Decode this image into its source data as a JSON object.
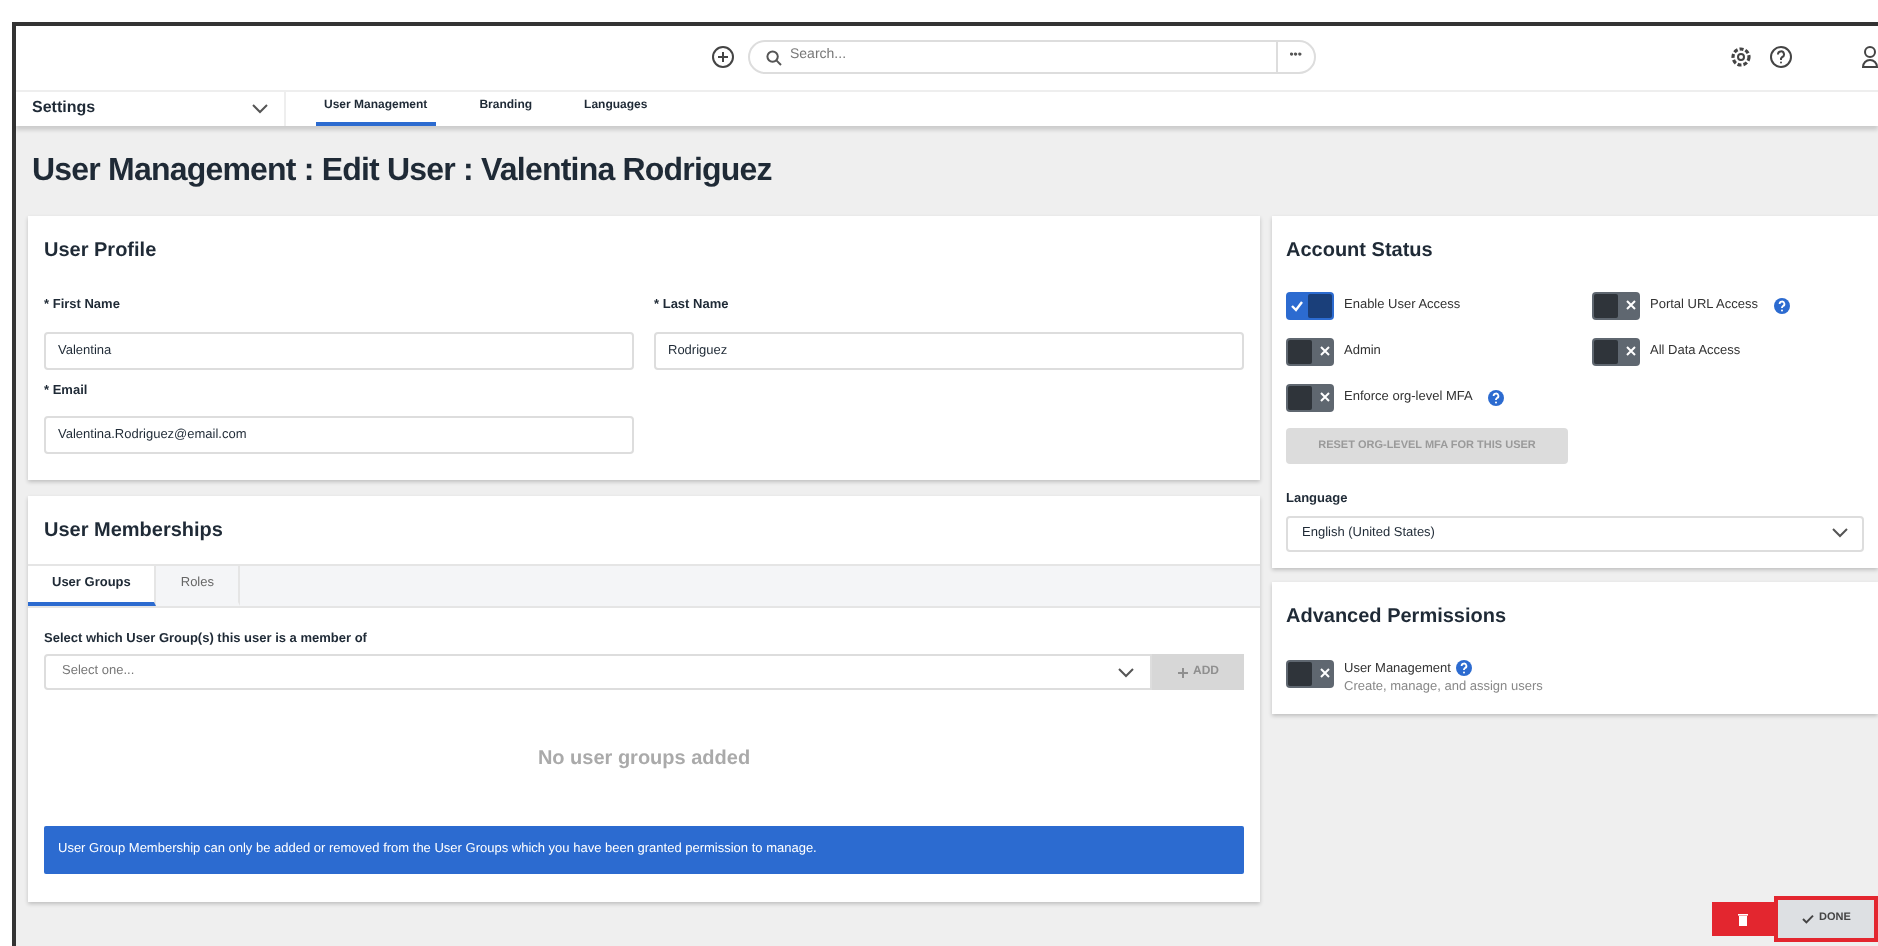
{
  "topbar": {
    "search": {
      "placeholder": "Search..."
    },
    "more": "•••"
  },
  "nav": {
    "section": "Settings",
    "tabs": [
      {
        "label": "User Management",
        "selected": true
      },
      {
        "label": "Branding",
        "selected": false
      },
      {
        "label": "Languages",
        "selected": false
      }
    ]
  },
  "title": {
    "parts": [
      "User Management",
      "Edit User",
      "Valentina Rodriguez"
    ],
    "separator": ":"
  },
  "profile": {
    "heading": "User Profile",
    "fields": [
      {
        "label": "First Name",
        "required": "*",
        "value": "Valentina"
      },
      {
        "label": "Last Name",
        "required": "*",
        "value": "Rodriguez"
      },
      {
        "label": "Email",
        "required": "*",
        "value": "Valentina.Rodriguez@email.com"
      }
    ]
  },
  "memberships": {
    "heading": "User Memberships",
    "tabs": [
      {
        "label": "User Groups",
        "selected": true
      },
      {
        "label": "Roles",
        "selected": false
      }
    ],
    "select_label": "Select which User Group(s) this user is a member of",
    "select": {
      "placeholder": "Select one..."
    },
    "add_button": "ADD",
    "empty": "No user groups added",
    "notice": "User Group Membership can only be added or removed from the User Groups which you have been granted permission to manage."
  },
  "account_status": {
    "heading": "Account Status",
    "toggles": [
      {
        "label": "Enable User Access",
        "on": true,
        "help": false
      },
      {
        "label": "Portal URL Access",
        "on": false,
        "help": true
      },
      {
        "label": "Admin",
        "on": false,
        "help": false
      },
      {
        "label": "All Data Access",
        "on": false,
        "help": false
      },
      {
        "label": "Enforce org-level MFA",
        "on": false,
        "help": true
      }
    ],
    "reset_button": "RESET ORG-LEVEL MFA FOR THIS USER",
    "language_label": "Language",
    "language": "English (United States)"
  },
  "advanced": {
    "heading": "Advanced Permissions",
    "toggles": [
      {
        "label": "User Management",
        "description": "Create, manage, and assign users",
        "on": false,
        "help": true
      }
    ]
  },
  "footer": {
    "done": "DONE"
  }
}
